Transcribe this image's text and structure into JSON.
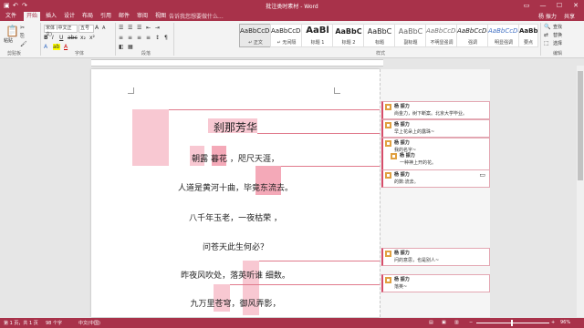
{
  "window": {
    "title": "批注类时素材 - Word"
  },
  "tabs": [
    "文件",
    "开始",
    "插入",
    "设计",
    "布局",
    "引用",
    "邮件",
    "审阅",
    "视图"
  ],
  "tell_me": "告诉我您想要做什么...",
  "user": {
    "name": "杨 振力",
    "share": "共享"
  },
  "ribbon": {
    "clipboard": {
      "paste": "粘贴",
      "label": "剪贴板"
    },
    "font": {
      "name": "宋体 (中文正文)",
      "size": "五号",
      "label": "字体"
    },
    "paragraph": {
      "label": "段落"
    },
    "styles": {
      "label": "样式",
      "items": [
        {
          "sample": "AaBbCcDd",
          "name": "↵ 正文"
        },
        {
          "sample": "AaBbCcDd",
          "name": "↵ 无间隔"
        },
        {
          "sample": "AaBl",
          "name": "标题 1"
        },
        {
          "sample": "AaBbC",
          "name": "标题 2"
        },
        {
          "sample": "AaBbC",
          "name": "标题"
        },
        {
          "sample": "AaBbC",
          "name": "副标题"
        },
        {
          "sample": "AaBbCcDd",
          "name": "不明显强调"
        },
        {
          "sample": "AaBbCcDd",
          "name": "强调"
        },
        {
          "sample": "AaBbCcDd",
          "name": "明显强调"
        },
        {
          "sample": "AaBbCcDc",
          "name": "要点"
        }
      ]
    },
    "editing": {
      "find": "查找",
      "replace": "替换",
      "select": "选择",
      "label": "编辑"
    }
  },
  "document": {
    "lines": [
      "刹那芳华",
      "朝露   暮花 ，咫尺天涯，",
      "人道是黄河十曲，毕竟东流去。",
      "八千年玉老，一夜枯荣  ，",
      "问苍天此生何必？",
      "昨夜风吹处，落英听谁  细数。",
      "九万里苍穹，御风弄影，"
    ]
  },
  "comments": [
    {
      "author": "杨 振力",
      "text": "尚金力，树下断案。北京大学毕业。"
    },
    {
      "author": "杨 振力",
      "text": "早上花朵上的露珠~"
    },
    {
      "author": "杨 振力",
      "text": "我的名字~"
    },
    {
      "author": "杨 振力",
      "text": "一种神上开的花。"
    },
    {
      "author": "杨 振力",
      "text": "的数:流去。"
    },
    {
      "author": "杨 振力",
      "text": "问的意思，也是别人~"
    },
    {
      "author": "杨 振力",
      "text": "落英~"
    }
  ],
  "status": {
    "page": "第 1 页，共 1 页",
    "words": "98 个字",
    "lang": "中文(中国)",
    "zoom": "96%"
  },
  "colors": {
    "accent": "#a8324a",
    "highlight": "#f8c8d2"
  }
}
